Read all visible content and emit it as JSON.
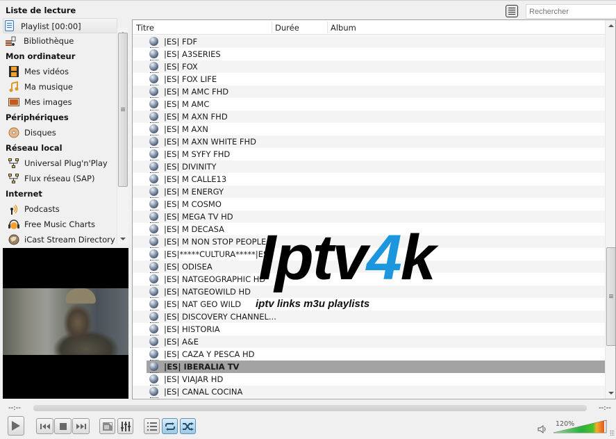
{
  "sidebar": {
    "title": "Liste de lecture",
    "groups": [
      {
        "type": "item",
        "label": "Playlist [00:00]",
        "icon": "playlist-icon",
        "selected": true
      },
      {
        "type": "item",
        "label": "Bibliothèque",
        "icon": "library-icon"
      },
      {
        "type": "category",
        "label": "Mon ordinateur"
      },
      {
        "type": "item",
        "label": "Mes vidéos",
        "icon": "film-icon"
      },
      {
        "type": "item",
        "label": "Ma musique",
        "icon": "music-note-icon"
      },
      {
        "type": "item",
        "label": "Mes images",
        "icon": "picture-icon"
      },
      {
        "type": "category",
        "label": "Périphériques"
      },
      {
        "type": "item",
        "label": "Disques",
        "icon": "disc-icon"
      },
      {
        "type": "category",
        "label": "Réseau local"
      },
      {
        "type": "item",
        "label": "Universal Plug'n'Play",
        "icon": "network-icon"
      },
      {
        "type": "item",
        "label": "Flux réseau (SAP)",
        "icon": "network-icon"
      },
      {
        "type": "category",
        "label": "Internet"
      },
      {
        "type": "item",
        "label": "Podcasts",
        "icon": "podcast-icon"
      },
      {
        "type": "item",
        "label": "Free Music Charts",
        "icon": "headphones-icon"
      },
      {
        "type": "item",
        "label": "iCast Stream Directory",
        "icon": "globe-icon"
      }
    ]
  },
  "search": {
    "placeholder": "Rechercher",
    "value": ""
  },
  "playlist": {
    "columns": [
      "Titre",
      "Durée",
      "Album"
    ],
    "items": [
      "|ES| FDF",
      "|ES| A3SERIES",
      "|ES| FOX",
      "|ES| FOX LIFE",
      "|ES| M AMC FHD",
      "|ES| M AMC",
      "|ES| M AXN FHD",
      "|ES| M AXN",
      "|ES| M AXN WHITE FHD",
      "|ES| M SYFY FHD",
      "|ES| DIVINITY",
      "|ES| M CALLE13",
      "|ES| M ENERGY",
      "|ES| M COSMO",
      "|ES| MEGA TV HD",
      "|ES| M DECASA",
      "|ES| M NON STOP PEOPLE",
      "|ES|*****CULTURA*****|ES|",
      "|ES| ODISEA",
      "|ES| NATGEOGRAPHIC HD",
      "|ES| NATGEOWILD HD",
      "|ES| NAT GEO WILD",
      "|ES| DISCOVERY CHANNEL...",
      "|ES| HISTORIA",
      "|ES| A&E",
      "|ES| CAZA Y PESCA HD",
      "|ES| IBERALIA TV",
      "|ES| VIAJAR HD",
      "|ES| CANAL COCINA"
    ],
    "active_index": 26
  },
  "watermark": {
    "brand_main": "Iptv",
    "brand_accent": "4",
    "brand_tail": "k",
    "tagline": "iptv links m3u playlists",
    "accent_color": "#1c97dd"
  },
  "controls": {
    "elapsed": "--:--",
    "remaining": "--:--",
    "seek_progress": 0,
    "volume_label": "120%",
    "volume_percent": 120,
    "loop_on": true,
    "shuffle_on": true
  }
}
